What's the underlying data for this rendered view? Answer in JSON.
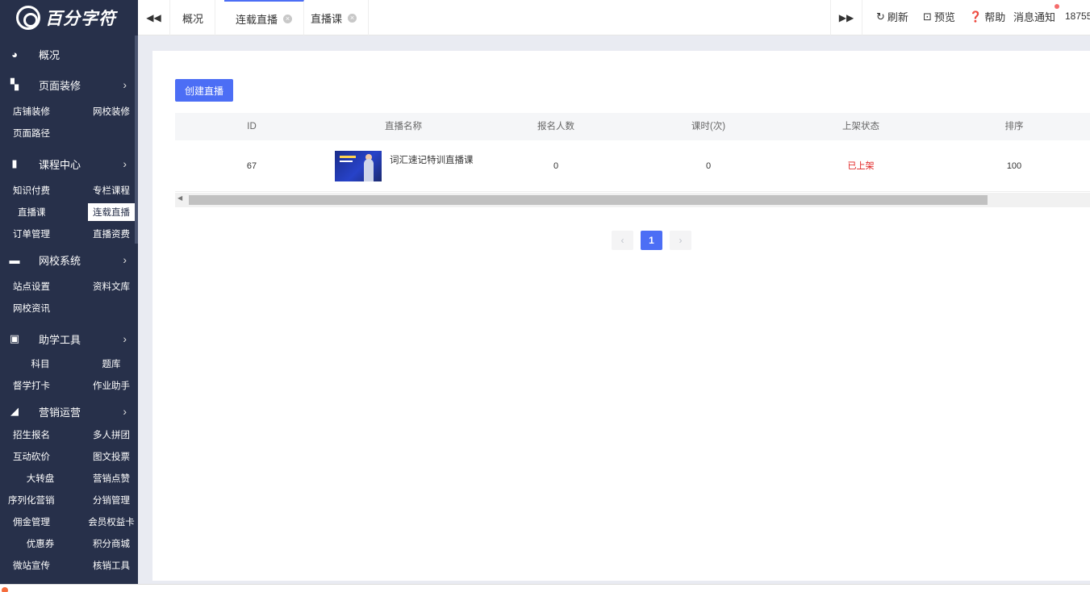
{
  "brand": {
    "name": "百分字符"
  },
  "sidebar": {
    "groups": [
      {
        "id": "overview",
        "label": "概况",
        "icon": "pie-chart-icon",
        "arrow": false,
        "items": []
      },
      {
        "id": "decor",
        "label": "页面装修",
        "icon": "brush-icon",
        "arrow": true,
        "items": [
          "店铺装修",
          "网校装修",
          "页面路径"
        ]
      },
      {
        "id": "course",
        "label": "课程中心",
        "icon": "book-icon",
        "arrow": true,
        "items": [
          "知识付费",
          "专栏课程",
          "直播课",
          "连载直播",
          "订单管理",
          "直播资费"
        ]
      },
      {
        "id": "school",
        "label": "网校系统",
        "icon": "monitor-icon",
        "arrow": true,
        "items": [
          "站点设置",
          "资料文库",
          "网校资讯"
        ]
      },
      {
        "id": "tools",
        "label": "助学工具",
        "icon": "briefcase-icon",
        "arrow": true,
        "items": [
          "科目",
          "题库",
          "督学打卡",
          "作业助手"
        ]
      },
      {
        "id": "marketing",
        "label": "营销运营",
        "icon": "megaphone-icon",
        "arrow": true,
        "items": [
          "招生报名",
          "多人拼团",
          "互动砍价",
          "图文投票",
          "大转盘",
          "营销点赞",
          "序列化营销",
          "分销管理",
          "佣金管理",
          "会员权益卡",
          "优惠券",
          "积分商城",
          "微站宣传",
          "核销工具"
        ]
      }
    ],
    "active_item": "连载直播"
  },
  "topbar": {
    "tabs": [
      {
        "label": "概况",
        "closable": false,
        "active": false
      },
      {
        "label": "连载直播",
        "closable": true,
        "active": true
      },
      {
        "label": "直播课",
        "closable": true,
        "active": false
      }
    ],
    "tools": {
      "refresh": "刷新",
      "preview": "预览",
      "help": "帮助",
      "notify": "消息通知",
      "user": "18755"
    }
  },
  "page": {
    "create_button": "创建直播",
    "table": {
      "columns": [
        "ID",
        "直播名称",
        "报名人数",
        "课时(次)",
        "上架状态",
        "排序"
      ],
      "rows": [
        {
          "id": "67",
          "name": "词汇速记特训直播课",
          "signups": "0",
          "lessons": "0",
          "status": "已上架",
          "sort": "100"
        }
      ]
    },
    "pagination": {
      "prev": "‹",
      "current": "1",
      "next": "›"
    }
  },
  "colors": {
    "sidebar_bg": "#27304a",
    "accent": "#4c6ef5",
    "status_on": "#e02020"
  }
}
